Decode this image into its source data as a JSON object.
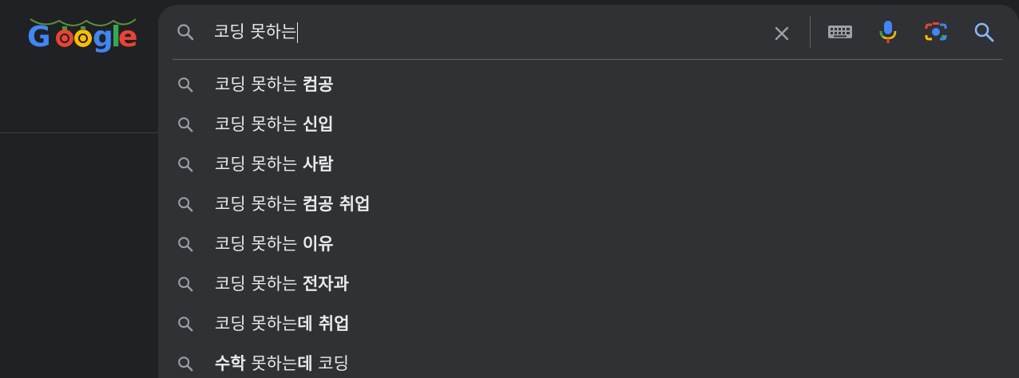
{
  "logo": {
    "text": "Google"
  },
  "search": {
    "query": "코딩 못하는"
  },
  "suggestions": [
    {
      "parts": [
        {
          "text": "코딩 못하는 ",
          "bold": false
        },
        {
          "text": "컴공",
          "bold": true
        }
      ]
    },
    {
      "parts": [
        {
          "text": "코딩 못하는 ",
          "bold": false
        },
        {
          "text": "신입",
          "bold": true
        }
      ]
    },
    {
      "parts": [
        {
          "text": "코딩 못하는 ",
          "bold": false
        },
        {
          "text": "사람",
          "bold": true
        }
      ]
    },
    {
      "parts": [
        {
          "text": "코딩 못하는 ",
          "bold": false
        },
        {
          "text": "컴공 취업",
          "bold": true
        }
      ]
    },
    {
      "parts": [
        {
          "text": "코딩 못하는 ",
          "bold": false
        },
        {
          "text": "이유",
          "bold": true
        }
      ]
    },
    {
      "parts": [
        {
          "text": "코딩 못하는 ",
          "bold": false
        },
        {
          "text": "전자과",
          "bold": true
        }
      ]
    },
    {
      "parts": [
        {
          "text": "코딩 못하는",
          "bold": false
        },
        {
          "text": "데 취업",
          "bold": true
        }
      ]
    },
    {
      "parts": [
        {
          "text": "수학",
          "bold": true
        },
        {
          "text": " 못하는",
          "bold": false
        },
        {
          "text": "데",
          "bold": true
        },
        {
          "text": " 코딩",
          "bold": false
        }
      ]
    }
  ],
  "icons": {
    "search": "search-icon",
    "clear": "close-icon",
    "keyboard": "keyboard-icon",
    "mic": "microphone-icon",
    "lens": "camera-lens-icon",
    "submit": "search-icon"
  },
  "colors": {
    "background": "#202124",
    "panel": "#303134",
    "text": "#e8eaed",
    "icon": "#9aa0a6",
    "accent_blue": "#8ab4f8"
  }
}
